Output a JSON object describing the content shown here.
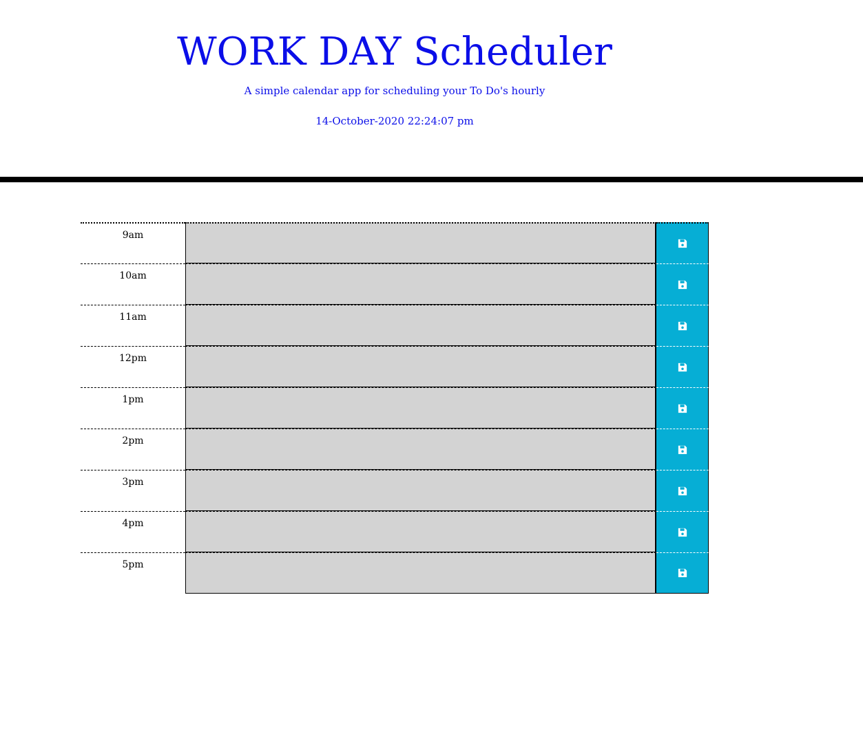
{
  "header": {
    "title": "WORK DAY Scheduler",
    "subtitle": "A simple calendar app for scheduling your To Do's hourly",
    "datetime": "14-October-2020 22:24:07 pm"
  },
  "colors": {
    "heading": "#0b0ee8",
    "past_block": "#d3d3d3",
    "save_button": "#06aed5"
  },
  "save_icon": "floppy-disk-icon",
  "time_blocks": [
    {
      "hour": "9am",
      "text": ""
    },
    {
      "hour": "10am",
      "text": ""
    },
    {
      "hour": "11am",
      "text": ""
    },
    {
      "hour": "12pm",
      "text": ""
    },
    {
      "hour": "1pm",
      "text": ""
    },
    {
      "hour": "2pm",
      "text": ""
    },
    {
      "hour": "3pm",
      "text": ""
    },
    {
      "hour": "4pm",
      "text": ""
    },
    {
      "hour": "5pm",
      "text": ""
    }
  ]
}
